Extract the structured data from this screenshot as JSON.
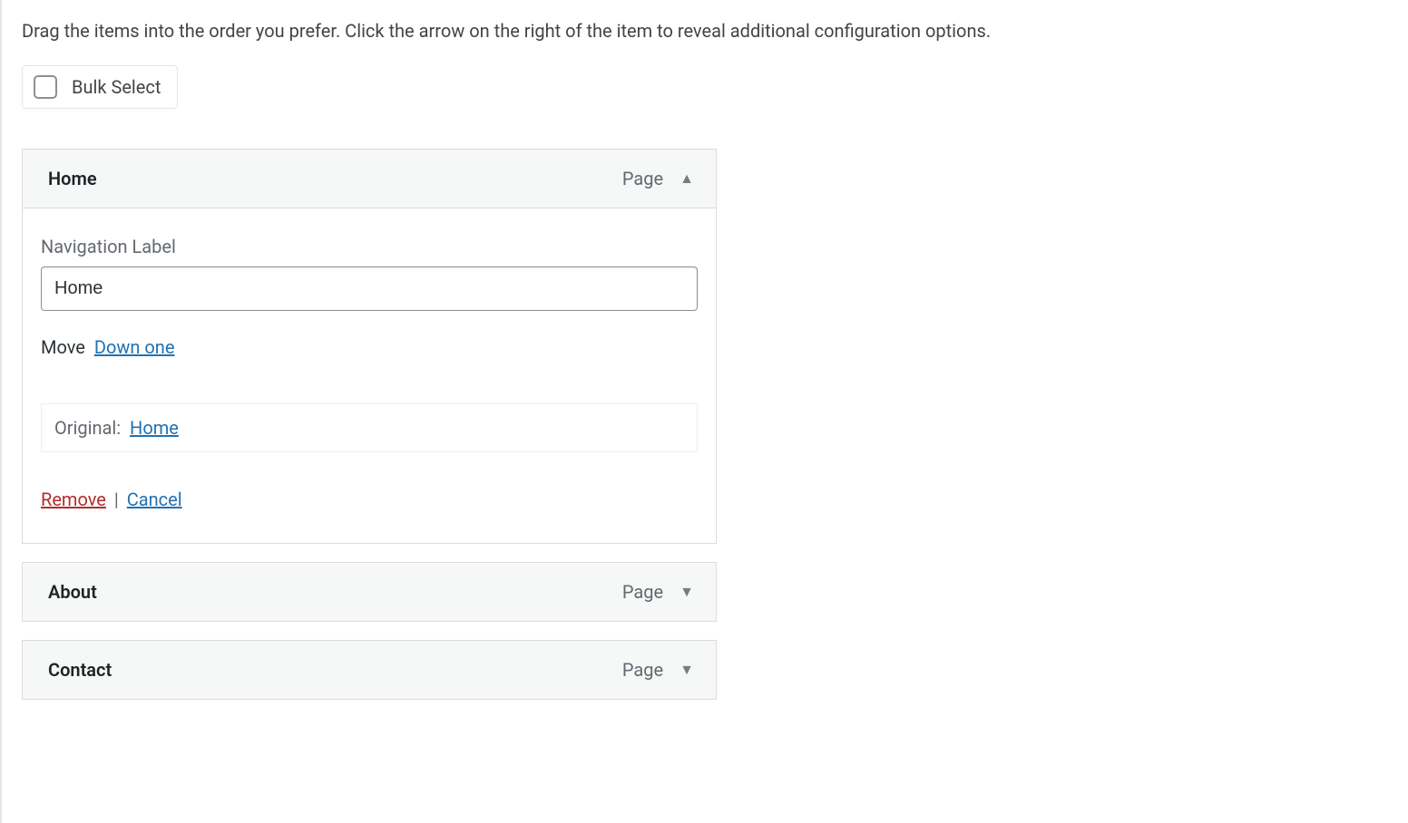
{
  "intro": "Drag the items into the order you prefer. Click the arrow on the right of the item to reveal additional configuration options.",
  "bulkSelect": {
    "label": "Bulk Select"
  },
  "navLabel": {
    "title": "Navigation Label",
    "value": "Home"
  },
  "move": {
    "label": "Move",
    "downOne": "Down one"
  },
  "original": {
    "prefix": "Original:",
    "link": "Home"
  },
  "actions": {
    "remove": "Remove",
    "sep": "|",
    "cancel": "Cancel"
  },
  "items": [
    {
      "title": "Home",
      "type": "Page",
      "expanded": true
    },
    {
      "title": "About",
      "type": "Page",
      "expanded": false
    },
    {
      "title": "Contact",
      "type": "Page",
      "expanded": false
    }
  ]
}
